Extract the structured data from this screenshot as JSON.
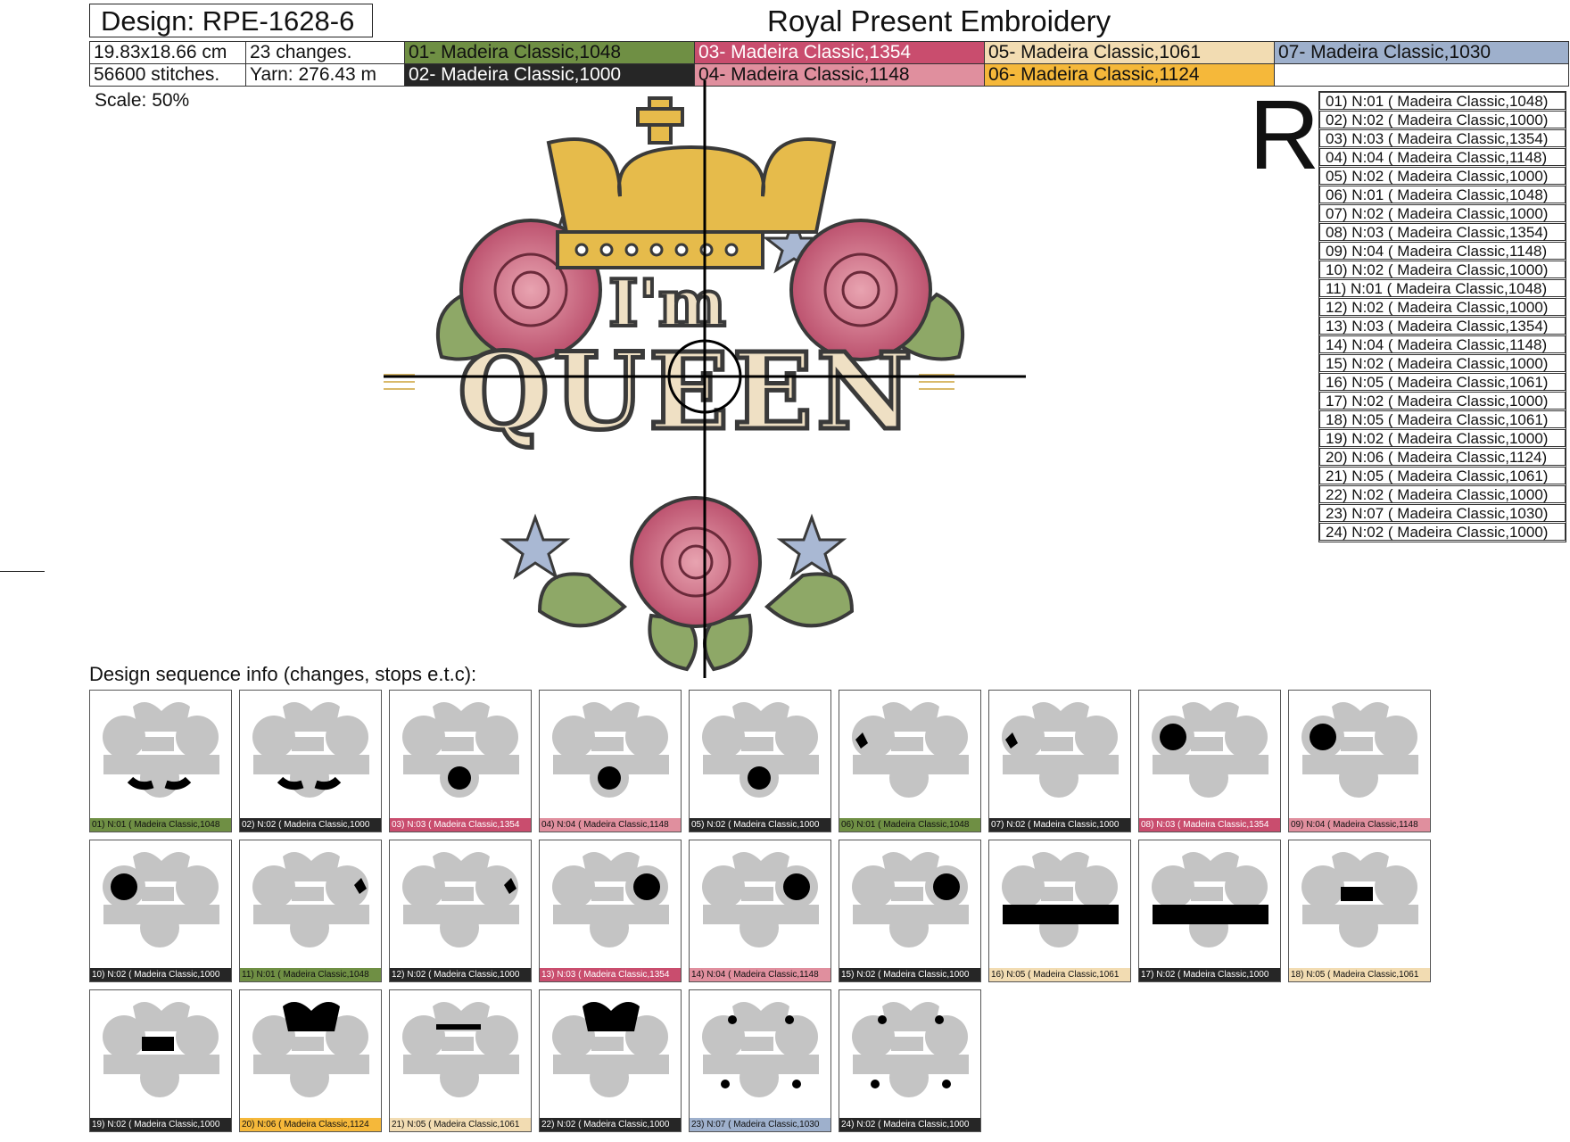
{
  "header": {
    "design_label": "Design: RPE-1628-6",
    "brand": "Royal Present Embroidery"
  },
  "info": {
    "size": "19.83x18.66 cm",
    "stitches": "56600 stitches.",
    "changes": "23 changes.",
    "yarn": "Yarn: 276.43 m"
  },
  "colors": [
    {
      "label": "01- Madeira Classic,1048",
      "bg": "#6f8f44",
      "fg": "#111111"
    },
    {
      "label": "02- Madeira Classic,1000",
      "bg": "#262626",
      "fg": "#ffffff"
    },
    {
      "label": "03- Madeira Classic,1354",
      "bg": "#c94d6e",
      "fg": "#ffffff"
    },
    {
      "label": "04- Madeira Classic,1148",
      "bg": "#e08f9e",
      "fg": "#111111"
    },
    {
      "label": "05- Madeira Classic,1061",
      "bg": "#f2dcb2",
      "fg": "#111111"
    },
    {
      "label": "06- Madeira Classic,1124",
      "bg": "#f5b83a",
      "fg": "#111111"
    },
    {
      "label": "07- Madeira Classic,1030",
      "bg": "#9eb0cc",
      "fg": "#111111"
    }
  ],
  "scale": "Scale: 50%",
  "orientation_letter": "R",
  "steps": [
    "01) N:01 ( Madeira Classic,1048)",
    "02) N:02 ( Madeira Classic,1000)",
    "03) N:03 ( Madeira Classic,1354)",
    "04) N:04 ( Madeira Classic,1148)",
    "05) N:02 ( Madeira Classic,1000)",
    "06) N:01 ( Madeira Classic,1048)",
    "07) N:02 ( Madeira Classic,1000)",
    "08) N:03 ( Madeira Classic,1354)",
    "09) N:04 ( Madeira Classic,1148)",
    "10) N:02 ( Madeira Classic,1000)",
    "11) N:01 ( Madeira Classic,1048)",
    "12) N:02 ( Madeira Classic,1000)",
    "13) N:03 ( Madeira Classic,1354)",
    "14) N:04 ( Madeira Classic,1148)",
    "15) N:02 ( Madeira Classic,1000)",
    "16) N:05 ( Madeira Classic,1061)",
    "17) N:02 ( Madeira Classic,1000)",
    "18) N:05 ( Madeira Classic,1061)",
    "19) N:02 ( Madeira Classic,1000)",
    "20) N:06 ( Madeira Classic,1124)",
    "21) N:05 ( Madeira Classic,1061)",
    "22) N:02 ( Madeira Classic,1000)",
    "23) N:07 ( Madeira Classic,1030)",
    "24) N:02 ( Madeira Classic,1000)"
  ],
  "sequence_title": "Design sequence info (changes, stops e.t.c):",
  "thumb_captions": [
    "01) N:01 ( Madeira Classic,1048",
    "02) N:02 ( Madeira Classic,1000",
    "03) N:03 ( Madeira Classic,1354",
    "04) N:04 ( Madeira Classic,1148",
    "05) N:02 ( Madeira Classic,1000",
    "06) N:01 ( Madeira Classic,1048",
    "07) N:02 ( Madeira Classic,1000",
    "08) N:03 ( Madeira Classic,1354",
    "09) N:04 ( Madeira Classic,1148",
    "10) N:02 ( Madeira Classic,1000",
    "11) N:01 ( Madeira Classic,1048",
    "12) N:02 ( Madeira Classic,1000",
    "13) N:03 ( Madeira Classic,1354",
    "14) N:04 ( Madeira Classic,1148",
    "15) N:02 ( Madeira Classic,1000",
    "16) N:05 ( Madeira Classic,1061",
    "17) N:02 ( Madeira Classic,1000",
    "18) N:05 ( Madeira Classic,1061",
    "19) N:02 ( Madeira Classic,1000",
    "20) N:06 ( Madeira Classic,1124",
    "21) N:05 ( Madeira Classic,1061",
    "22) N:02 ( Madeira Classic,1000",
    "23) N:07 ( Madeira Classic,1030",
    "24) N:02 ( Madeira Classic,1000"
  ],
  "thumb_color_index": [
    0,
    1,
    2,
    3,
    1,
    0,
    1,
    2,
    3,
    1,
    0,
    1,
    2,
    3,
    1,
    4,
    1,
    4,
    1,
    5,
    4,
    1,
    6,
    1
  ],
  "thumb_highlight": [
    "leaves-bottom",
    "leaves-bottom",
    "rose-bottom",
    "rose-bottom",
    "rose-bottom",
    "leaf-left",
    "leaf-left",
    "rose-left",
    "rose-left",
    "rose-left",
    "leaf-right",
    "leaf-right",
    "rose-right",
    "rose-right",
    "rose-right",
    "queen",
    "queen",
    "im",
    "im",
    "crown",
    "crown-band",
    "crown",
    "stars",
    "stars"
  ],
  "design_text": {
    "im": "I'm",
    "queen": "QUEEN"
  }
}
